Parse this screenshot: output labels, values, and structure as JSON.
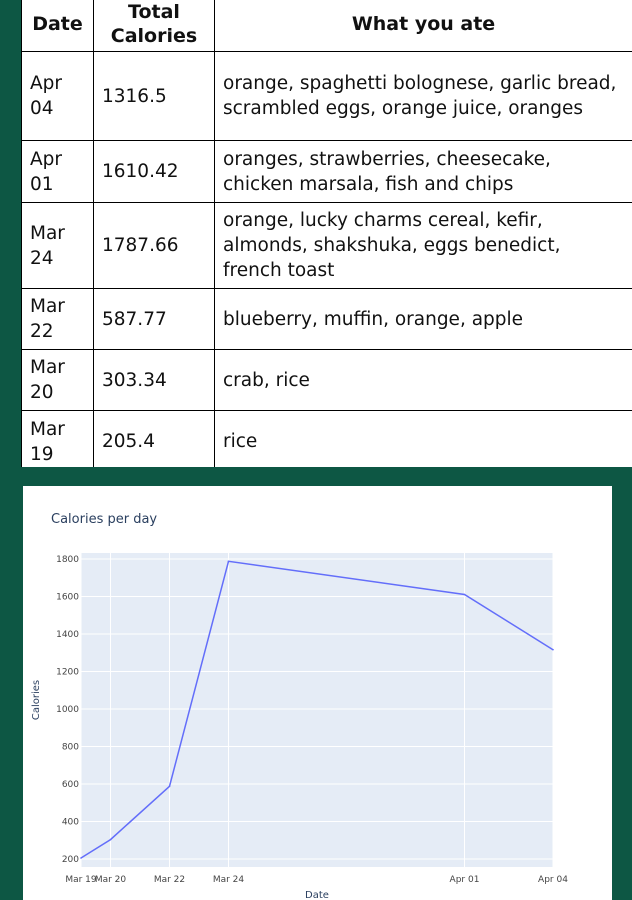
{
  "table": {
    "headers": {
      "date": "Date",
      "calories": "Total Calories",
      "food": "What you ate"
    },
    "rows": [
      {
        "date": "Apr 04",
        "calories": "1316.5",
        "food": "orange, spaghetti bolognese, garlic bread, scrambled eggs, orange juice, oranges"
      },
      {
        "date": "Apr 01",
        "calories": "1610.42",
        "food": "oranges, strawberries, cheesecake, chicken marsala, fish and chips"
      },
      {
        "date": "Mar 24",
        "calories": "1787.66",
        "food": "orange, lucky charms cereal, kefir, almonds, shakshuka, eggs benedict, french toast"
      },
      {
        "date": "Mar 22",
        "calories": "587.77",
        "food": "blueberry, muffin, orange, apple"
      },
      {
        "date": "Mar 20",
        "calories": "303.34",
        "food": "crab, rice"
      },
      {
        "date": "Mar 19",
        "calories": "205.4",
        "food": "rice"
      }
    ]
  },
  "colors": {
    "page_background": "#0d5744",
    "plot_background": "#e5ecf6",
    "line": "#636efa"
  },
  "chart_data": {
    "type": "line",
    "title": "Calories per day",
    "xlabel": "Date",
    "ylabel": "Calories",
    "x": [
      "Mar 19",
      "Mar 20",
      "Mar 22",
      "Mar 24",
      "Apr 01",
      "Apr 04"
    ],
    "x_tick_labels": [
      "Mar 19",
      "Mar 20",
      "Mar 22",
      "Mar 24",
      "Apr 01",
      "Apr 04"
    ],
    "series": [
      {
        "values": [
          205.4,
          303.34,
          587.77,
          1787.66,
          1610.42,
          1316.5
        ]
      }
    ],
    "ylim": [
      200,
      1800
    ],
    "y_ticks": [
      "200",
      "400",
      "600",
      "800",
      "1000",
      "1200",
      "1400",
      "1600",
      "1800"
    ],
    "grid": true
  }
}
